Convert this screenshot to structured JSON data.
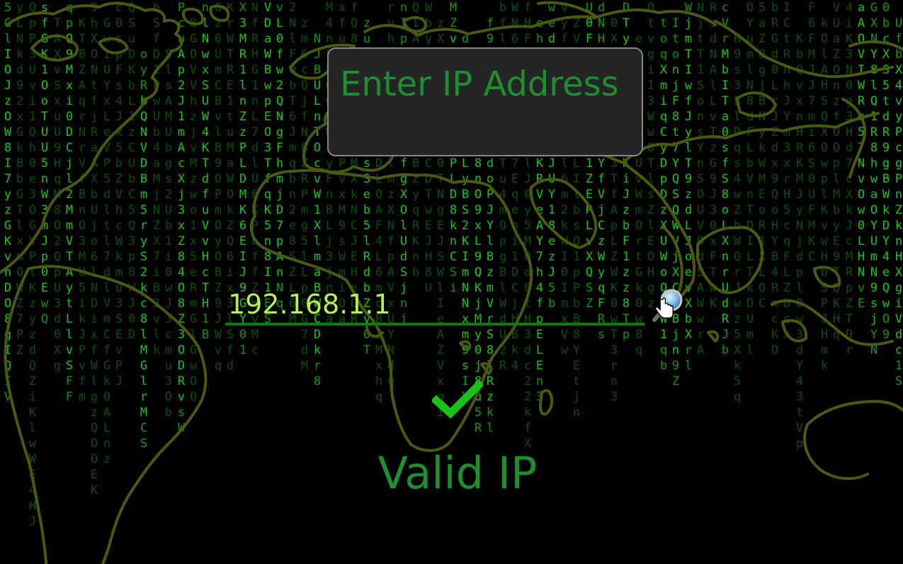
{
  "form": {
    "title_placeholder": "Enter IP Address",
    "ip_value": "192.168.1.1",
    "status_text": "Valid IP"
  },
  "icons": {
    "search": "magnifier-icon",
    "cursor": "hand-pointer-icon",
    "status": "checkmark-icon"
  },
  "colors": {
    "background": "#000000",
    "title_text": "#1e8f2e",
    "input_text": "#b7f254",
    "input_underline": "#0e7a10",
    "checkmark": "#19c219",
    "map_outline": "#4a5a10",
    "rain_bright": "#18c418",
    "rain_dim": "#0b4d0b"
  },
  "rain_columns": [
    "5GlIOJzOW8I7yzGKvnDO8gIQIV",
    "uUyLNkd92xGkBbGTlxmOWZ7PZ",
    "QpP3Uvi1Qh0e3OGVPlKzyzdQZiKlwWE4HJ",
    "wLPsfGK1OoTUU5nW3mJp0EwQ",
    "TAXvSxuU9HqM8O2QpU3d0Xg",
    "5qpQ9Mxi0DCjl2MmVTAytLlvSFF",
    "KTBZAqrNrVfBnO3MU5ikJPvfm",
    "9hXONtfjRaAXbUjo6lNDixfWlgzQOOEK",
    "GwiUYxLeVP5dltl7dlVmCfGk0ALnz",
    "c0spFs4Jx5bZVhcWkmu3SEvPJ",
    "dMQSuDKbL1zCUbC5Q3p8WJ0D",
    "oyRbQNVDBm5ryS2kc8lMGlrMCS",
    "vfhSfD1PwUb4aMjNZX7iB2vlk",
    "SlsAMUbgs2Ub1i0wJ3cmu3Ob",
    "PcuAp2J1mAcXj3xZ84O8Z3ODRvsW",
    "8GOVVhzjvMzwo1x5eRmGlGwOQ",
    "cZnlNwxSUW4KTdfuVvHcTH1B",
    "Gz6UmCBvlB9OPmOyOBZ9JWvq",
    "KrWTRE1tuMaWOkZQ6ix3lSfd",
    "1yX3MR1lnZzPLDMK6EIJ9GY01",
    "bNfRHG1nL7dlU6KPbffZWvMc",
    "nhcVDaWBwpEO3TfqK5n8I1ES",
    "TbvL0fw2QNgFhmjD7pAnNq",
    "2NlFQbT6Jmqbn2e8SZL6M",
    "zm6cQjfN8ZRPmg5lLp0G7dM",
    "NJBULnTOcvW1XlmaBWCDkr8",
    "7UM4nFbGwwWsyFnBLj3jnKa",
    "xfuFKEIPEQPvxM9sWmiOa",
    "QvTfQ8YmQxFVWMXkNCJEHeOR",
    "zuU7PtOrGsSeb5lRdbZv0T",
    "NhlKvGBDLQAF4L6mcBIMxhq",
    "rvhJhjFQWzlmzXNfpAVxUYNdq",
    "nIpHlSv5XNfgXOlUdSjnj",
    "QIAVUOTlxuBZyqRKnb",
    "QWbyMFoLPaWCDTwEJH8U",
    "zXbz1nOlB0TNgEJSWlIeAZVxqI",
    "cMZv2lpr0BTPLD8knCSi",
    "dXsp1MtuLyBS2KImNNxm9sIY",
    "bOQ2CF08nO9xL9QKjMy0j8u5R",
    "f9tV0wWMndoPJYlBzmVrS8lRzkl",
    "bflO00yW8DTu4mOpgBlWdU2R",
    "vWN6ArSJ5AW7Eqeoi1DCjHBk4",
    "LXfHFEtXzUtulJ0y5M0d0tH3dc22kfX",
    "ehbPrHXqGKRVeAY7h4fpELEn3",
    "ewedhbaysFSJUY18ezJ5b",
    "hOrvyfMVIbOpnl6m2kWI0ImxVw",
    "ZV7iuzyJNLIlbsQ1pPbB8YEtjn",
    "QWU0F3cZRbLJ1ZERLvXQSZ",
    "dNHQEo2cUKYfVjCzWyqFRs",
    "0XM2J8ryb3TfApLZWK0wT3rn3",
    "QWDTyLVQrlVSKiJzbF1zz8Tp",
    "ewMLnXpCUvWmOrtGk0w8q",
    "pHNQtvgiI3Ww8TlsZlEOHgz",
    "toqXmiqCyDpDzXUWoQaW1qb",
    "ItonjF8t7YQSQWVjXCXBjn9Z",
    "BDWjmTIwfJylT9zdLJoevXbXrl",
    "WTNjtT1SonsYnSOUVOd5AWwrA",
    "XpyRsdNAlLvTzG9J30xFTwK",
    "cVrMbITa0sfS8oLXnrUdRJb",
    "H9s35lDqs4wZhWQrJwz5Xk5q",
    "OYumlN8dFLbVnTDILTkDUml",
    "c5aZ8gjBNykWMEoR1XLOC",
    "WXWbRGd0LrJZdx9QoHYB4RmcKO",
    "p4ICtRnhJYm3xrH5cqFLZbcx",
    "KbQvxnHRKMJyNjdpl0w3dY43tVp",
    "KaF6FMJJ7mi6S0UFMKC",
    "kOlAHSQXOwplKvwHbSPJHmk",
    "kVUaZOnzfUQplMbyE9TQKHq",
    "4iK3N0g3Hd7cXkJcMRpZTDr",
    "aScaAQVIWRe57NvOw0LHNvE",
    "GXNY8lQ1R8hwaOYUmN9sjYN",
    "q0bcXS5tdR9gBWkDY4eQwO9",
    "UfbX4vyPcgPnZknHXgiVdc1S"
  ]
}
